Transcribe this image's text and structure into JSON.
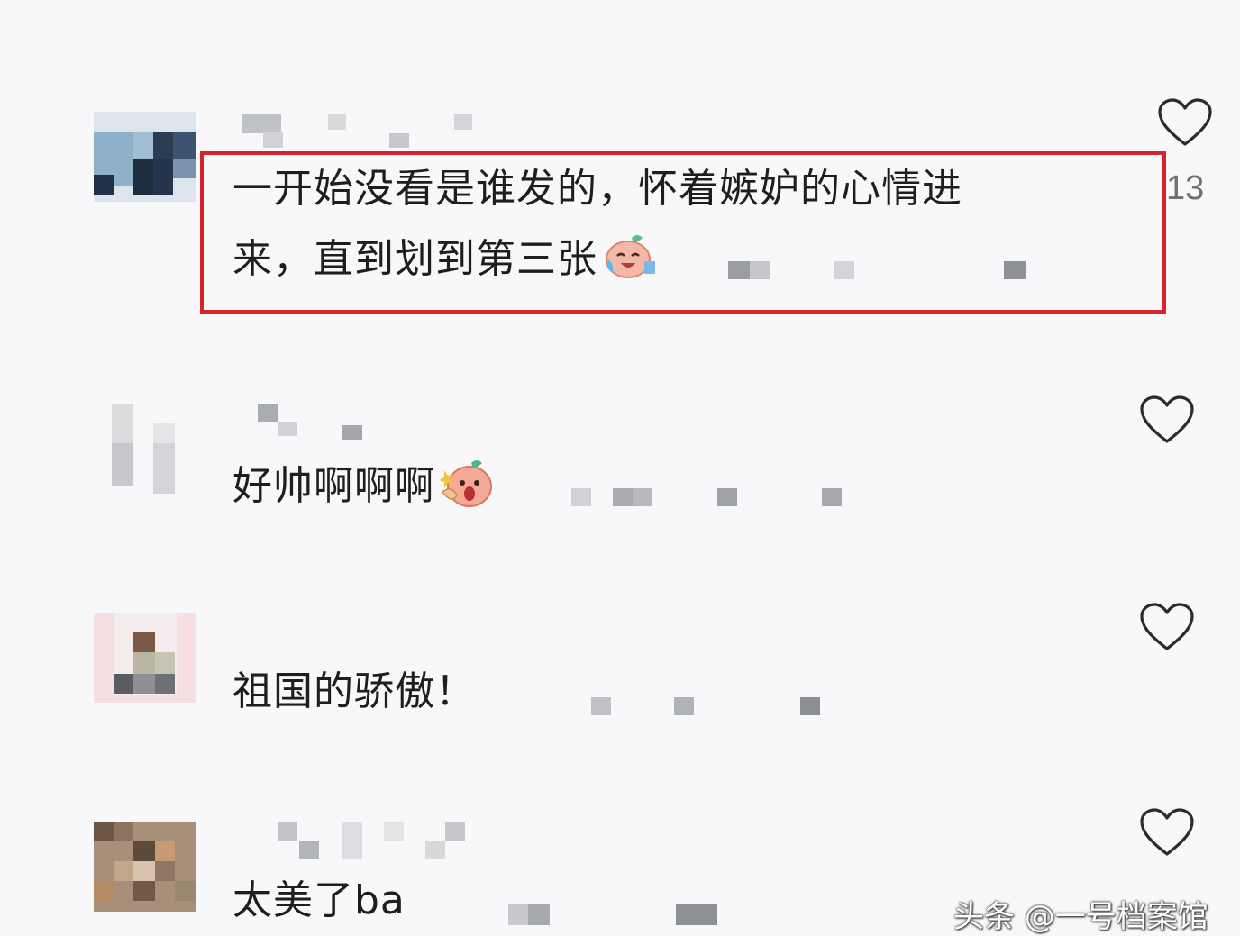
{
  "comments": [
    {
      "text_line1": "一开始没看是谁发的，怀着嫉妒的心情进",
      "text_line2": "来，直到划到第三张",
      "emoji": "laughing-crying-face-icon",
      "likes": "13"
    },
    {
      "text": "好帅啊啊啊",
      "emoji": "excited-face-icon",
      "likes": ""
    },
    {
      "text": "祖国的骄傲！",
      "likes": ""
    },
    {
      "text": "太美了ba",
      "likes": ""
    }
  ],
  "watermark": "头条 @一号档案馆",
  "colors": {
    "highlight": "#d7232c",
    "background": "#f8f8fa",
    "text": "#1e1e1e",
    "heart": "#2b2b2b"
  }
}
